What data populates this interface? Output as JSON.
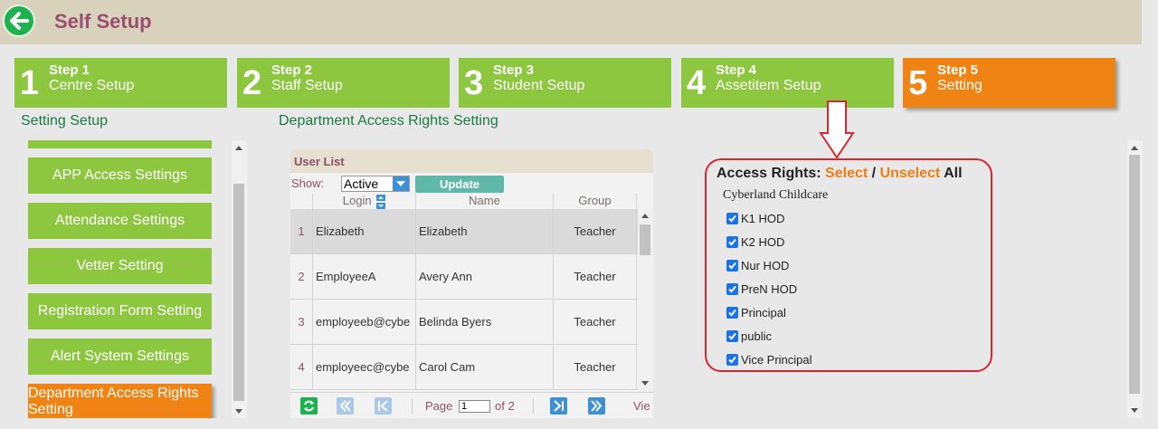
{
  "header": {
    "title": "Self Setup",
    "back_icon": "back-arrow-icon",
    "bg_color": "#d8d2bc"
  },
  "steps": [
    {
      "num": "1",
      "label1": "Step 1",
      "label2": "Centre Setup",
      "active": false
    },
    {
      "num": "2",
      "label1": "Step 2",
      "label2": "Staff Setup",
      "active": false
    },
    {
      "num": "3",
      "label1": "Step 3",
      "label2": "Student Setup",
      "active": false
    },
    {
      "num": "4",
      "label1": "Step 4",
      "label2": "Assetitem Setup",
      "active": false
    },
    {
      "num": "5",
      "label1": "Step 5",
      "label2": "Setting",
      "active": true
    }
  ],
  "colors": {
    "green": "#8dc63f",
    "orange": "#ef8414",
    "red": "#d8252f"
  },
  "setting_setup": {
    "title": "Setting Setup",
    "items": [
      {
        "label": "APP Access Settings",
        "active": false
      },
      {
        "label": "Attendance Settings",
        "active": false
      },
      {
        "label": "Vetter Setting",
        "active": false
      },
      {
        "label": "Registration Form Setting",
        "active": false
      },
      {
        "label": "Alert System Settings",
        "active": false
      },
      {
        "label": "Department Access Rights Setting",
        "active": true
      }
    ]
  },
  "dept": {
    "title": "Department Access Rights Setting",
    "user_list": {
      "title": "User List",
      "show_label": "Show:",
      "show_value": "Active",
      "update_label": "Update",
      "columns": [
        "Login",
        "Name",
        "Group"
      ],
      "rows": [
        {
          "n": "1",
          "login": "Elizabeth",
          "name": "Elizabeth",
          "group": "Teacher"
        },
        {
          "n": "2",
          "login": "EmployeeA",
          "name": "Avery Ann",
          "group": "Teacher"
        },
        {
          "n": "3",
          "login": "employeeb@cybe",
          "name": "Belinda Byers",
          "group": "Teacher"
        },
        {
          "n": "4",
          "login": "employeec@cybe",
          "name": "Carol Cam",
          "group": "Teacher"
        }
      ],
      "pager": {
        "page_label": "Page",
        "page_value": "1",
        "of_label": "of 2",
        "view_label": "Vie"
      }
    }
  },
  "access_rights": {
    "label": "Access Rights:",
    "select": "Select",
    "sep": "/",
    "unselect": "Unselect",
    "all": "All",
    "org": "Cyberland Childcare",
    "items": [
      {
        "label": "K1 HOD",
        "checked": true
      },
      {
        "label": "K2 HOD",
        "checked": true
      },
      {
        "label": "Nur HOD",
        "checked": true
      },
      {
        "label": "PreN HOD",
        "checked": true
      },
      {
        "label": "Principal",
        "checked": true
      },
      {
        "label": "public",
        "checked": true
      },
      {
        "label": "Vice Principal",
        "checked": true
      }
    ]
  }
}
